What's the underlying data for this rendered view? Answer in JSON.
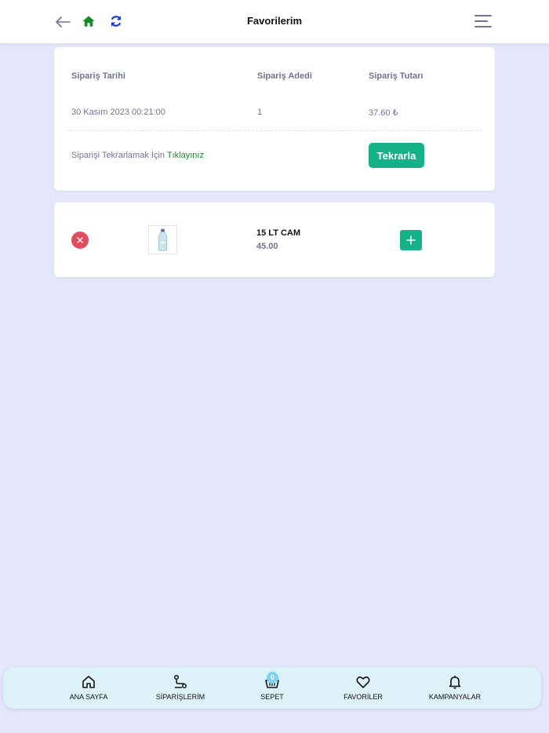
{
  "header": {
    "title": "Favorilerim",
    "icons": [
      "arrow-left-icon",
      "home-icon",
      "refresh-icon",
      "menu-icon"
    ],
    "colors": {
      "home": "#1a8a2a",
      "refresh": "#1a3fd6"
    }
  },
  "order": {
    "headers": {
      "date": "Sipariş Tarihi",
      "count": "Sipariş Adedi",
      "total": "Sipariş Tutarı"
    },
    "values": {
      "date": "30 Kasım 2023 00:21:00",
      "count": "1",
      "total": "37.60 ₺"
    },
    "repeat_prompt": "Siparişi Tekrarlamak İçin",
    "repeat_link": "Tıklayınız",
    "repeat_button": "Tekrarla"
  },
  "favorites": [
    {
      "name": "15 LT CAM",
      "price": "45.00",
      "image": "water-bottle-image"
    }
  ],
  "bottom_nav": {
    "items": [
      {
        "label": "ANA SAYFA",
        "icon": "home-outline-icon"
      },
      {
        "label": "SİPARİŞLERİM",
        "icon": "route-icon"
      },
      {
        "label": "SEPET",
        "icon": "basket-icon",
        "badge": "0"
      },
      {
        "label": "FAVORİLER",
        "icon": "heart-icon"
      },
      {
        "label": "KAMPANYALAR",
        "icon": "bell-icon"
      }
    ]
  },
  "colors": {
    "background": "#e4e6fb",
    "accent": "#15b28a",
    "danger": "#e24a5e",
    "nav_bg": "#ddf1f8",
    "muted_text": "#6f7390"
  }
}
